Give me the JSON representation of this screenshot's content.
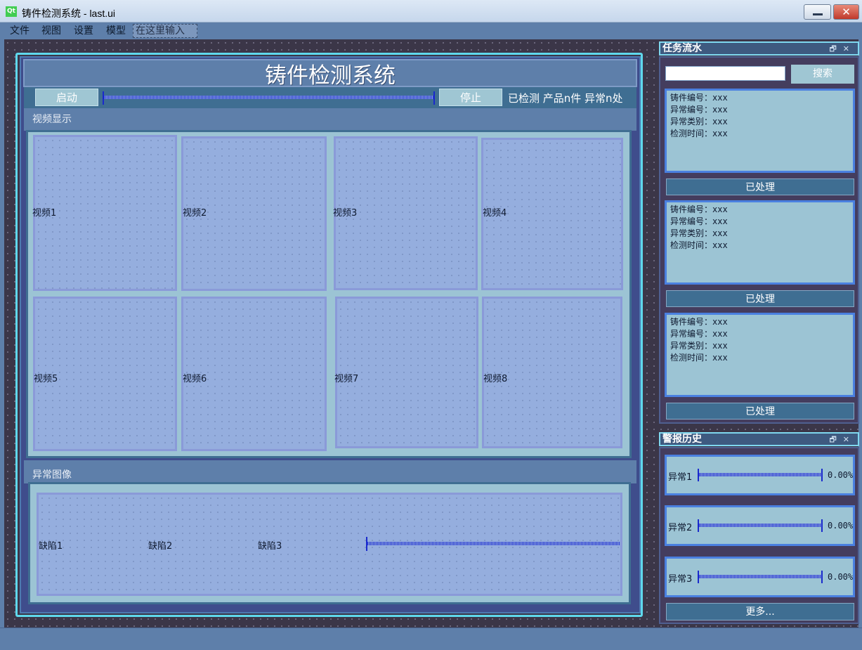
{
  "window": {
    "title": "铸件检测系统 - last.ui",
    "logo_text": "Qt",
    "close_glyph": "✕"
  },
  "menu": [
    "文件",
    "视图",
    "设置",
    "模型",
    "在这里输入"
  ],
  "main": {
    "title": "铸件检测系统",
    "start_label": "启动",
    "stop_label": "停止",
    "status": "已检测 产品n件 异常n处",
    "video_section": "视频显示",
    "videos": [
      "视频1",
      "视频2",
      "视频3",
      "视频4",
      "视频5",
      "视频6",
      "视频7",
      "视频8"
    ],
    "abnormal_section": "异常图像",
    "defects": [
      "缺陷1",
      "缺陷2",
      "缺陷3"
    ]
  },
  "tasks_dock": {
    "title": "任务流水",
    "search_label": "搜索",
    "search_value": "",
    "cards": [
      {
        "text": "铸件编号：xxx\n异常编号：xxx\n异常类别：xxx\n检测时间：xxx",
        "button": "已处理"
      },
      {
        "text": "铸件编号：xxx\n异常编号：xxx\n异常类别：xxx\n检测时间：xxx",
        "button": "已处理"
      },
      {
        "text": "铸件编号：xxx\n异常编号：xxx\n异常类别：xxx\n检测时间：xxx",
        "button": "已处理"
      }
    ]
  },
  "alarm_dock": {
    "title": "警报历史",
    "items": [
      {
        "label": "异常1",
        "value": "0.00%"
      },
      {
        "label": "异常2",
        "value": "0.00%"
      },
      {
        "label": "异常3",
        "value": "0.00%"
      }
    ],
    "more_label": "更多..."
  },
  "dock_icons": "🗗✕",
  "colors": {
    "accent": "#5fd8ec",
    "panel": "#9cc4d4",
    "button": "#3f6e92",
    "canvas": "#3b3648"
  }
}
